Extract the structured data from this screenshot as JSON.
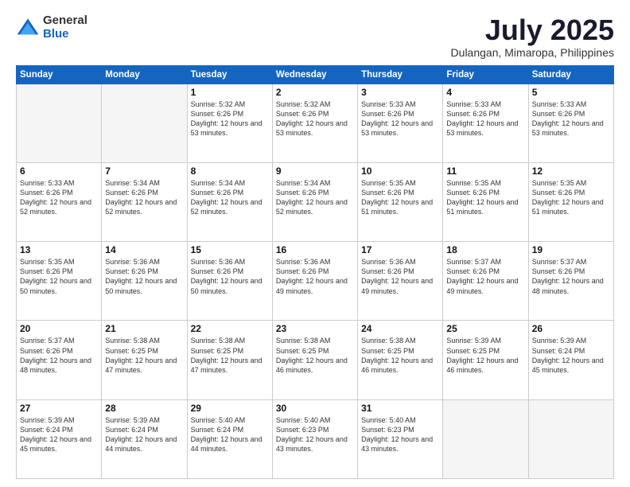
{
  "logo": {
    "general": "General",
    "blue": "Blue"
  },
  "header": {
    "month": "July 2025",
    "location": "Dulangan, Mimaropa, Philippines"
  },
  "weekdays": [
    "Sunday",
    "Monday",
    "Tuesday",
    "Wednesday",
    "Thursday",
    "Friday",
    "Saturday"
  ],
  "weeks": [
    [
      {
        "day": "",
        "empty": true
      },
      {
        "day": "",
        "empty": true
      },
      {
        "day": "1",
        "sunrise": "5:32 AM",
        "sunset": "6:26 PM",
        "daylight": "12 hours and 53 minutes."
      },
      {
        "day": "2",
        "sunrise": "5:32 AM",
        "sunset": "6:26 PM",
        "daylight": "12 hours and 53 minutes."
      },
      {
        "day": "3",
        "sunrise": "5:33 AM",
        "sunset": "6:26 PM",
        "daylight": "12 hours and 53 minutes."
      },
      {
        "day": "4",
        "sunrise": "5:33 AM",
        "sunset": "6:26 PM",
        "daylight": "12 hours and 53 minutes."
      },
      {
        "day": "5",
        "sunrise": "5:33 AM",
        "sunset": "6:26 PM",
        "daylight": "12 hours and 53 minutes."
      }
    ],
    [
      {
        "day": "6",
        "sunrise": "5:33 AM",
        "sunset": "6:26 PM",
        "daylight": "12 hours and 52 minutes."
      },
      {
        "day": "7",
        "sunrise": "5:34 AM",
        "sunset": "6:26 PM",
        "daylight": "12 hours and 52 minutes."
      },
      {
        "day": "8",
        "sunrise": "5:34 AM",
        "sunset": "6:26 PM",
        "daylight": "12 hours and 52 minutes."
      },
      {
        "day": "9",
        "sunrise": "5:34 AM",
        "sunset": "6:26 PM",
        "daylight": "12 hours and 52 minutes."
      },
      {
        "day": "10",
        "sunrise": "5:35 AM",
        "sunset": "6:26 PM",
        "daylight": "12 hours and 51 minutes."
      },
      {
        "day": "11",
        "sunrise": "5:35 AM",
        "sunset": "6:26 PM",
        "daylight": "12 hours and 51 minutes."
      },
      {
        "day": "12",
        "sunrise": "5:35 AM",
        "sunset": "6:26 PM",
        "daylight": "12 hours and 51 minutes."
      }
    ],
    [
      {
        "day": "13",
        "sunrise": "5:35 AM",
        "sunset": "6:26 PM",
        "daylight": "12 hours and 50 minutes."
      },
      {
        "day": "14",
        "sunrise": "5:36 AM",
        "sunset": "6:26 PM",
        "daylight": "12 hours and 50 minutes."
      },
      {
        "day": "15",
        "sunrise": "5:36 AM",
        "sunset": "6:26 PM",
        "daylight": "12 hours and 50 minutes."
      },
      {
        "day": "16",
        "sunrise": "5:36 AM",
        "sunset": "6:26 PM",
        "daylight": "12 hours and 49 minutes."
      },
      {
        "day": "17",
        "sunrise": "5:36 AM",
        "sunset": "6:26 PM",
        "daylight": "12 hours and 49 minutes."
      },
      {
        "day": "18",
        "sunrise": "5:37 AM",
        "sunset": "6:26 PM",
        "daylight": "12 hours and 49 minutes."
      },
      {
        "day": "19",
        "sunrise": "5:37 AM",
        "sunset": "6:26 PM",
        "daylight": "12 hours and 48 minutes."
      }
    ],
    [
      {
        "day": "20",
        "sunrise": "5:37 AM",
        "sunset": "6:26 PM",
        "daylight": "12 hours and 48 minutes."
      },
      {
        "day": "21",
        "sunrise": "5:38 AM",
        "sunset": "6:25 PM",
        "daylight": "12 hours and 47 minutes."
      },
      {
        "day": "22",
        "sunrise": "5:38 AM",
        "sunset": "6:25 PM",
        "daylight": "12 hours and 47 minutes."
      },
      {
        "day": "23",
        "sunrise": "5:38 AM",
        "sunset": "6:25 PM",
        "daylight": "12 hours and 46 minutes."
      },
      {
        "day": "24",
        "sunrise": "5:38 AM",
        "sunset": "6:25 PM",
        "daylight": "12 hours and 46 minutes."
      },
      {
        "day": "25",
        "sunrise": "5:39 AM",
        "sunset": "6:25 PM",
        "daylight": "12 hours and 46 minutes."
      },
      {
        "day": "26",
        "sunrise": "5:39 AM",
        "sunset": "6:24 PM",
        "daylight": "12 hours and 45 minutes."
      }
    ],
    [
      {
        "day": "27",
        "sunrise": "5:39 AM",
        "sunset": "6:24 PM",
        "daylight": "12 hours and 45 minutes."
      },
      {
        "day": "28",
        "sunrise": "5:39 AM",
        "sunset": "6:24 PM",
        "daylight": "12 hours and 44 minutes."
      },
      {
        "day": "29",
        "sunrise": "5:40 AM",
        "sunset": "6:24 PM",
        "daylight": "12 hours and 44 minutes."
      },
      {
        "day": "30",
        "sunrise": "5:40 AM",
        "sunset": "6:23 PM",
        "daylight": "12 hours and 43 minutes."
      },
      {
        "day": "31",
        "sunrise": "5:40 AM",
        "sunset": "6:23 PM",
        "daylight": "12 hours and 43 minutes."
      },
      {
        "day": "",
        "empty": true
      },
      {
        "day": "",
        "empty": true
      }
    ]
  ]
}
